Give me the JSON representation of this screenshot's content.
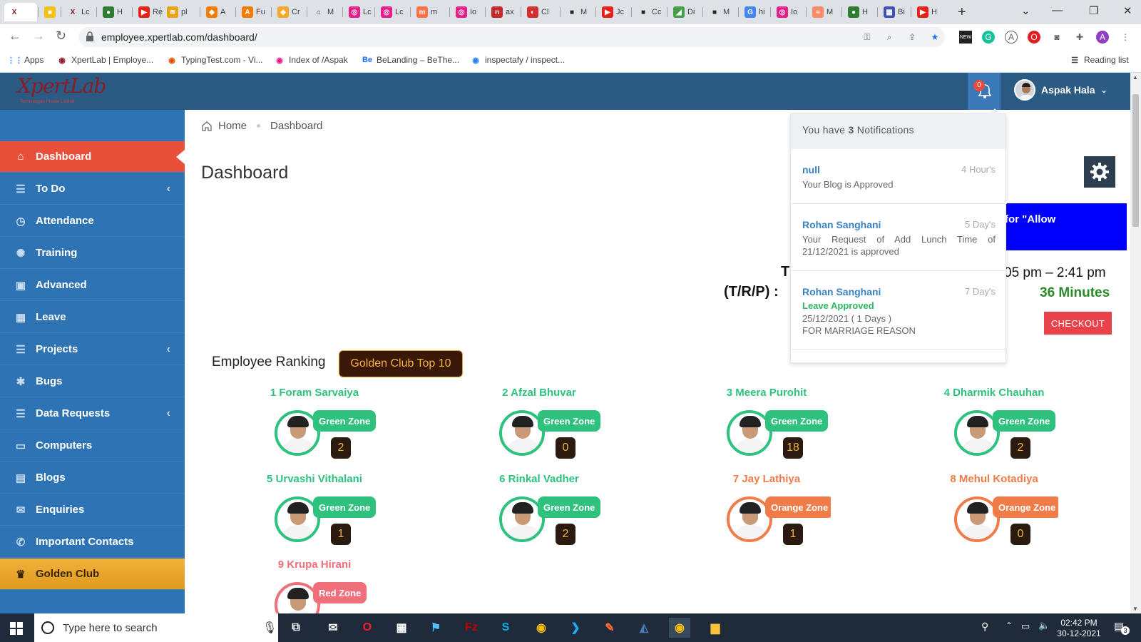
{
  "browser": {
    "tabs": [
      {
        "label": "",
        "icon": "xpertlab-favicon",
        "color": "#ffffff",
        "glyph": "X"
      },
      {
        "label": "",
        "icon": "yellow-favicon",
        "color": "#f4c20d",
        "glyph": "■"
      },
      {
        "label": "Lc",
        "icon": "xpertlab-favicon",
        "color": "#ffffff",
        "glyph": "X"
      },
      {
        "label": "H",
        "icon": "globe-favicon",
        "color": "#2e7d32",
        "glyph": "●"
      },
      {
        "label": "Re",
        "icon": "youtube-favicon",
        "color": "#e62117",
        "glyph": "▶"
      },
      {
        "label": "pl",
        "icon": "chart-favicon",
        "color": "#e8a317",
        "glyph": "≋"
      },
      {
        "label": "A",
        "icon": "box-favicon",
        "color": "#f57c00",
        "glyph": "◆"
      },
      {
        "label": "Fu",
        "icon": "orange-favicon",
        "color": "#f57c00",
        "glyph": "A"
      },
      {
        "label": "Cr",
        "icon": "cube-favicon",
        "color": "#f9a825",
        "glyph": "◈"
      },
      {
        "label": "M",
        "icon": "house-favicon",
        "color": "#222222",
        "glyph": "⌂"
      },
      {
        "label": "Lc",
        "icon": "pink-favicon",
        "color": "#e91e8c",
        "glyph": "◎"
      },
      {
        "label": "Lc",
        "icon": "pink-favicon",
        "color": "#e91e8c",
        "glyph": "◎"
      },
      {
        "label": "m",
        "icon": "orange-favicon",
        "color": "#ff7043",
        "glyph": "m"
      },
      {
        "label": "Io",
        "icon": "pink-favicon",
        "color": "#e91e8c",
        "glyph": "◎"
      },
      {
        "label": "ax",
        "icon": "red-favicon",
        "color": "#c62828",
        "glyph": "n"
      },
      {
        "label": "Cl",
        "icon": "red-favicon",
        "color": "#d32f2f",
        "glyph": "◐"
      },
      {
        "label": "M",
        "icon": "terminal-favicon",
        "color": "#222222",
        "glyph": "■"
      },
      {
        "label": "Jc",
        "icon": "youtube-favicon",
        "color": "#e62117",
        "glyph": "▶"
      },
      {
        "label": "Cc",
        "icon": "terminal-favicon",
        "color": "#222222",
        "glyph": "■"
      },
      {
        "label": "Di",
        "icon": "green-favicon",
        "color": "#43a047",
        "glyph": "◢"
      },
      {
        "label": "M",
        "icon": "terminal-favicon",
        "color": "#222222",
        "glyph": "■"
      },
      {
        "label": "hi",
        "icon": "google-favicon",
        "color": "#4285f4",
        "glyph": "G"
      },
      {
        "label": "Io",
        "icon": "pink-favicon",
        "color": "#e91e8c",
        "glyph": "◎"
      },
      {
        "label": "M",
        "icon": "wave-favicon",
        "color": "#ff8a65",
        "glyph": "≈"
      },
      {
        "label": "H",
        "icon": "globe-favicon",
        "color": "#2e7d32",
        "glyph": "●"
      },
      {
        "label": "Bi",
        "icon": "multi-favicon",
        "color": "#3f51b5",
        "glyph": "▦"
      },
      {
        "label": "H",
        "icon": "youtube-favicon",
        "color": "#e62117",
        "glyph": "▶"
      }
    ],
    "url": "employee.xpertlab.com/dashboard/",
    "bookmarks": [
      {
        "label": "Apps",
        "icon": "apps-grid-icon",
        "color": "#4285f4"
      },
      {
        "label": "XpertLab | Employe...",
        "icon": "xpertlab-favicon",
        "color": "#8a1c2a"
      },
      {
        "label": "TypingTest.com - Vi...",
        "icon": "typingtest-favicon",
        "color": "#e65100"
      },
      {
        "label": "Index of /Aspak",
        "icon": "pink-favicon",
        "color": "#e91e8c"
      },
      {
        "label": "BeLanding – BeThe...",
        "icon": "behance-favicon",
        "color": "#1769ff"
      },
      {
        "label": "inspectafy / inspect...",
        "icon": "bitbucket-favicon",
        "color": "#2684ff"
      }
    ],
    "reading_list": "Reading list",
    "profile_initial": "A"
  },
  "header": {
    "logo_text": "XpertLab",
    "logo_sub": "Technologies Private Limited",
    "notification_count": "0",
    "user_name": "Aspak Hala"
  },
  "sidebar": {
    "items": [
      {
        "label": "Dashboard",
        "icon": "home-icon",
        "glyph": "⌂",
        "active": true,
        "arrow": false
      },
      {
        "label": "To Do",
        "icon": "list-icon",
        "glyph": "☰",
        "active": false,
        "arrow": true
      },
      {
        "label": "Attendance",
        "icon": "clock-icon",
        "glyph": "◷",
        "active": false,
        "arrow": false
      },
      {
        "label": "Training",
        "icon": "gear-icon",
        "glyph": "✺",
        "active": false,
        "arrow": false
      },
      {
        "label": "Advanced",
        "icon": "money-icon",
        "glyph": "▣",
        "active": false,
        "arrow": false
      },
      {
        "label": "Leave",
        "icon": "calendar-icon",
        "glyph": "▦",
        "active": false,
        "arrow": false
      },
      {
        "label": "Projects",
        "icon": "list-icon",
        "glyph": "☰",
        "active": false,
        "arrow": true
      },
      {
        "label": "Bugs",
        "icon": "bug-icon",
        "glyph": "✱",
        "active": false,
        "arrow": false
      },
      {
        "label": "Data Requests",
        "icon": "list-icon",
        "glyph": "☰",
        "active": false,
        "arrow": true
      },
      {
        "label": "Computers",
        "icon": "monitor-icon",
        "glyph": "▭",
        "active": false,
        "arrow": false
      },
      {
        "label": "Blogs",
        "icon": "newspaper-icon",
        "glyph": "▤",
        "active": false,
        "arrow": false
      },
      {
        "label": "Enquiries",
        "icon": "envelope-icon",
        "glyph": "✉",
        "active": false,
        "arrow": false
      },
      {
        "label": "Important Contacts",
        "icon": "phone-icon",
        "glyph": "✆",
        "active": false,
        "arrow": false
      },
      {
        "label": "Golden Club",
        "icon": "trophy-icon",
        "glyph": "♛",
        "active": false,
        "arrow": false
      }
    ]
  },
  "breadcrumb": {
    "home": "Home",
    "current": "Dashboard"
  },
  "page_title": "Dashboard",
  "banner_text": "for \"Allow",
  "time": {
    "partial_label": "T",
    "trp_label": "(T/R/P) :",
    "range": "05 pm – 2:41 pm",
    "minutes": "36 Minutes"
  },
  "checkout_label": "CHECKOUT",
  "notifications": {
    "header_prefix": "You have",
    "count": "3",
    "header_suffix": "Notifications",
    "items": [
      {
        "name": "null",
        "time": "4 Hour's",
        "status": "",
        "text": "Your Blog is Approved"
      },
      {
        "name": "Rohan Sanghani",
        "time": "5 Day's",
        "status": "",
        "text": "Your Request of Add Lunch Time of 21/12/2021 is approved"
      },
      {
        "name": "Rohan Sanghani",
        "time": "7 Day's",
        "status": "Leave Approved",
        "text": "25/12/2021 ( 1 Days )\nFOR MARRIAGE REASON"
      }
    ]
  },
  "ranking": {
    "title": "Employee Ranking",
    "badge": "Golden Club Top 10",
    "employees": [
      {
        "name": "1 Foram Sarvaiya",
        "zone": "Green Zone",
        "count": "2",
        "color": "#2ec27e"
      },
      {
        "name": "2 Afzal Bhuvar",
        "zone": "Green Zone",
        "count": "0",
        "color": "#2ec27e"
      },
      {
        "name": "3 Meera Purohit",
        "zone": "Green Zone",
        "count": "18",
        "color": "#2ec27e"
      },
      {
        "name": "4 Dharmik Chauhan",
        "zone": "Green Zone",
        "count": "2",
        "color": "#2ec27e"
      },
      {
        "name": "5 Urvashi Vithalani",
        "zone": "Green Zone",
        "count": "1",
        "color": "#2ec27e"
      },
      {
        "name": "6 Rinkal Vadher",
        "zone": "Green Zone",
        "count": "2",
        "color": "#2ec27e"
      },
      {
        "name": "7 Jay Lathiya",
        "zone": "Orange Zone",
        "count": "1",
        "color": "#f07c4a"
      },
      {
        "name": "8 Mehul Kotadiya",
        "zone": "Orange Zone",
        "count": "0",
        "color": "#f07c4a"
      },
      {
        "name": "9 Krupa Hirani",
        "zone": "Red Zone",
        "count": "",
        "color": "#ef6f7a"
      }
    ]
  },
  "taskbar": {
    "search_placeholder": "Type here to search",
    "time": "02:42 PM",
    "date": "30-12-2021",
    "notif_count": "3",
    "apps": [
      {
        "icon": "task-view-icon",
        "glyph": "⧉",
        "color": "#ffffff"
      },
      {
        "icon": "mail-icon",
        "glyph": "✉",
        "color": "#ffffff"
      },
      {
        "icon": "opera-icon",
        "glyph": "O",
        "color": "#ff1b2d"
      },
      {
        "icon": "store-icon",
        "glyph": "▦",
        "color": "#ffffff"
      },
      {
        "icon": "flag-app-icon",
        "glyph": "⚑",
        "color": "#4fc3f7"
      },
      {
        "icon": "filezilla-icon",
        "glyph": "Fz",
        "color": "#bf0000"
      },
      {
        "icon": "skype-icon",
        "glyph": "S",
        "color": "#00aff0"
      },
      {
        "icon": "chrome-icon",
        "glyph": "◉",
        "color": "#fbbc05"
      },
      {
        "icon": "vscode-icon",
        "glyph": "❯",
        "color": "#23a9f2"
      },
      {
        "icon": "postman-icon",
        "glyph": "✎",
        "color": "#ff6c37"
      },
      {
        "icon": "mysql-workbench-icon",
        "glyph": "◭",
        "color": "#4a7ab0"
      },
      {
        "icon": "chrome-icon",
        "glyph": "◉",
        "color": "#fbbc05"
      },
      {
        "icon": "file-explorer-icon",
        "glyph": "▆",
        "color": "#f9c23c"
      }
    ]
  }
}
